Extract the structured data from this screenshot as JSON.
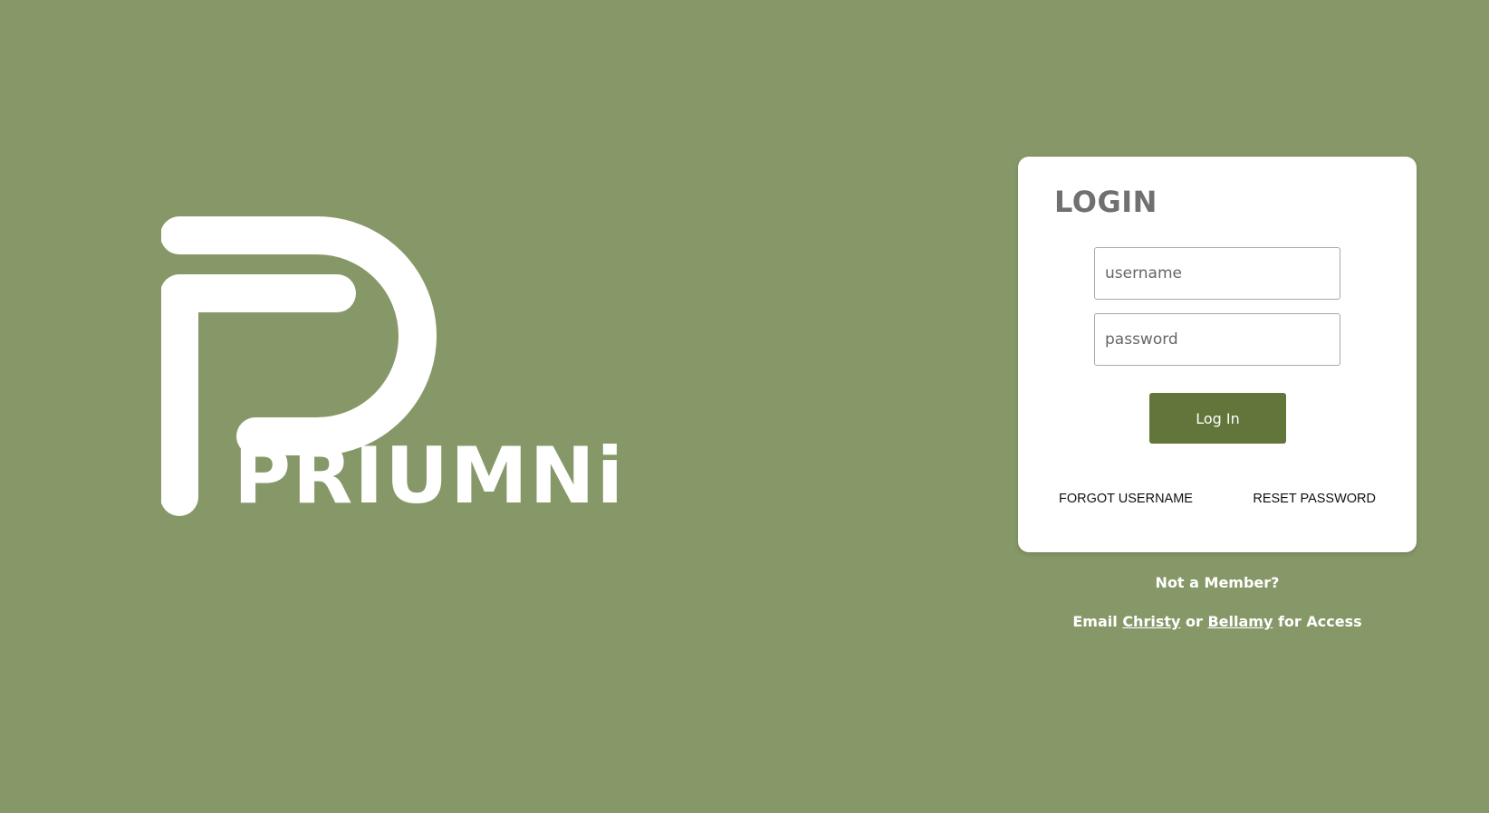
{
  "brand": {
    "name": "PRIUMNi",
    "logo_icon": "priumni-p-logo-icon",
    "logo_color": "#ffffff",
    "background_color": "#879868"
  },
  "login": {
    "title": "LOGIN",
    "username_placeholder": "username",
    "password_placeholder": "password",
    "submit_label": "Log In",
    "button_color": "#62753a",
    "forgot_username_label": "FORGOT USERNAME",
    "reset_password_label": "RESET PASSWORD"
  },
  "membership": {
    "not_member_text": "Not a Member?",
    "email_prefix": "Email",
    "contact_1": "Christy",
    "conjunction": "or",
    "contact_2": "Bellamy",
    "email_suffix": "for Access"
  }
}
